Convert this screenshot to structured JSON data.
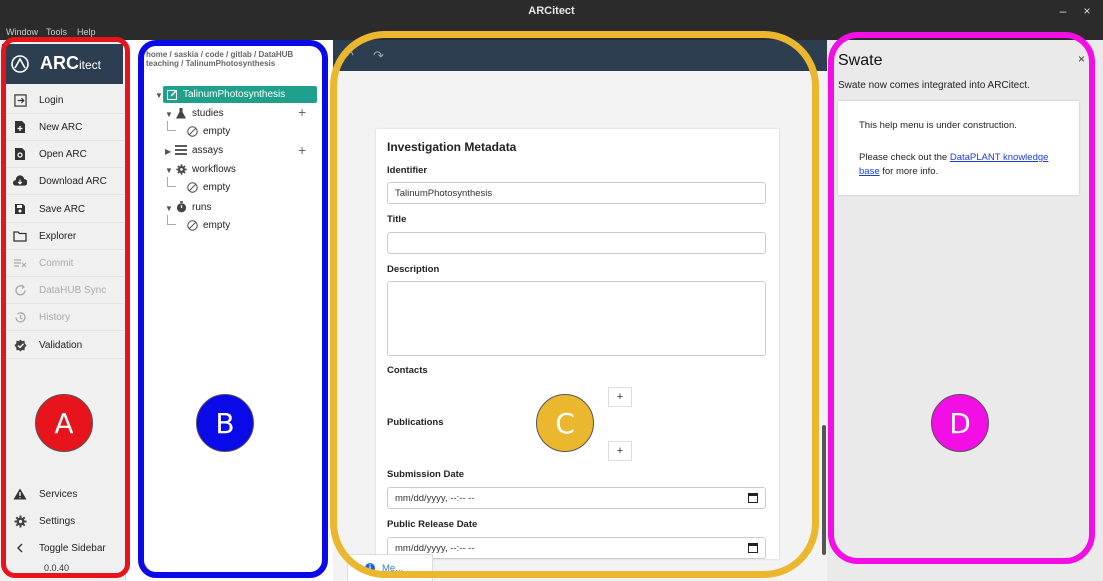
{
  "window": {
    "title": "ARCitect",
    "menu": [
      "Window",
      "Tools",
      "Help"
    ],
    "controls": [
      "–",
      "×"
    ]
  },
  "sidebar": {
    "logo": {
      "strong": "ARC",
      "light": "itect"
    },
    "items": [
      {
        "label": "Login",
        "icon": "login-icon",
        "enabled": true
      },
      {
        "label": "New ARC",
        "icon": "new-file-icon",
        "enabled": true
      },
      {
        "label": "Open ARC",
        "icon": "open-file-icon",
        "enabled": true
      },
      {
        "label": "Download ARC",
        "icon": "cloud-download-icon",
        "enabled": true
      },
      {
        "label": "Save ARC",
        "icon": "save-icon",
        "enabled": true
      },
      {
        "label": "Explorer",
        "icon": "folder-icon",
        "enabled": true
      },
      {
        "label": "Commit",
        "icon": "commit-icon",
        "enabled": false
      },
      {
        "label": "DataHUB Sync",
        "icon": "sync-icon",
        "enabled": false
      },
      {
        "label": "History",
        "icon": "history-icon",
        "enabled": false
      },
      {
        "label": "Validation",
        "icon": "validation-icon",
        "enabled": true
      }
    ],
    "bottom_items": [
      {
        "label": "Services",
        "icon": "warning-icon"
      },
      {
        "label": "Settings",
        "icon": "gear-icon"
      },
      {
        "label": "Toggle Sidebar",
        "icon": "chevron-left-icon"
      }
    ],
    "version": "0.0.40"
  },
  "tree": {
    "breadcrumb_line1": "home / saskia / code / gitlab / DataHUB",
    "breadcrumb_line2": "teaching / TalinumPhotosynthesis",
    "root": "TalinumPhotosynthesis",
    "studies": "studies",
    "assays": "assays",
    "workflows": "workflows",
    "runs": "runs",
    "empty": "empty"
  },
  "form": {
    "heading": "Investigation Metadata",
    "identifier_label": "Identifier",
    "identifier_value": "TalinumPhotosynthesis",
    "title_label": "Title",
    "title_value": "",
    "description_label": "Description",
    "description_value": "",
    "contacts_label": "Contacts",
    "publications_label": "Publications",
    "add_symbol": "+",
    "submission_date_label": "Submission Date",
    "submission_date_value": "mm/dd/yyyy, --:-- --",
    "public_release_label": "Public Release Date",
    "public_release_value": "mm/dd/yyyy, --:-- --",
    "bottom_tab": "Me..."
  },
  "swate": {
    "title": "Swate",
    "subtitle": "Swate now comes integrated into ARCitect.",
    "line1": "This help menu is under construction.",
    "line2_pre": "Please check out the ",
    "line2_link": "DataPLANT knowledge base",
    "line2_post": " for more info."
  },
  "annotations": [
    {
      "letter": "A",
      "color": "#e8141c"
    },
    {
      "letter": "B",
      "color": "#0a0ae8"
    },
    {
      "letter": "C",
      "color": "#eab72e"
    },
    {
      "letter": "D",
      "color": "#f20ee4"
    }
  ]
}
